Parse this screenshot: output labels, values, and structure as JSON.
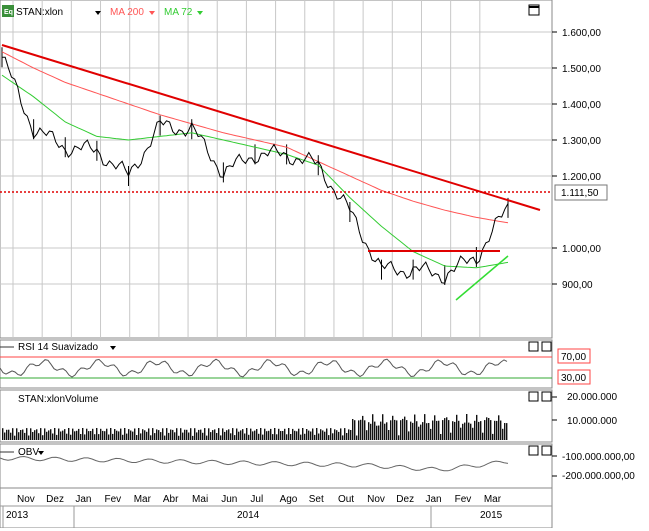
{
  "colors": {
    "price": "#000000",
    "ma200": "#ff5555",
    "ma72": "#33cc33",
    "trendline": "#e00000",
    "support_line": "#33dd33",
    "rsi_band": "#ff4444",
    "rsi_mid": "#33aa33",
    "grid": "#c8c8c8",
    "axis_text": "#000000"
  },
  "main": {
    "symbol_label": "STAN:xlon",
    "symbol_icon": "eq-badge",
    "ma200_label": "MA 200",
    "ma72_label": "MA 72",
    "last_price_label": "1.111,50",
    "y_ticks": [
      {
        "value": 1600,
        "label": "1.600,00"
      },
      {
        "value": 1500,
        "label": "1.500,00"
      },
      {
        "value": 1400,
        "label": "1.400,00"
      },
      {
        "value": 1300,
        "label": "1.300,00"
      },
      {
        "value": 1200,
        "label": "1.200,00"
      },
      {
        "value": 1000,
        "label": "1.000,00"
      },
      {
        "value": 900,
        "label": "900,00"
      }
    ]
  },
  "rsi": {
    "label": "RSI 14 Suavizado",
    "upper_label": "70,00",
    "lower_label": "30,00"
  },
  "volume": {
    "label": "STAN:xlonVolume",
    "ticks": [
      "20.000.000",
      "10.000.000"
    ]
  },
  "obv": {
    "label": "OBV",
    "ticks": [
      "-100.000.000,00",
      "-200.000.000,00"
    ]
  },
  "x_axis": {
    "months": [
      "Nov",
      "Dez",
      "Jan",
      "Fev",
      "Mar",
      "Abr",
      "Mai",
      "Jun",
      "Jul",
      "Ago",
      "Set",
      "Out",
      "Nov",
      "Dez",
      "Jan",
      "Fev",
      "Mar"
    ],
    "years": [
      "2013",
      "2014",
      "2015"
    ]
  },
  "chart_data": {
    "type": "line",
    "title": "STAN:xlon",
    "ylim": [
      820,
      1650
    ],
    "ylabel": "",
    "xlabel": "",
    "x": [
      "Nov 2013",
      "Dez 2013",
      "Jan 2014",
      "Fev 2014",
      "Mar 2014",
      "Abr 2014",
      "Mai 2014",
      "Jun 2014",
      "Jul 2014",
      "Ago 2014",
      "Set 2014",
      "Out 2014",
      "Nov 2014",
      "Dez 2014",
      "Jan 2015",
      "Fev 2015",
      "Mar 2015"
    ],
    "series": [
      {
        "name": "STAN:xlon",
        "values": [
          1530,
          1330,
          1280,
          1270,
          1200,
          1340,
          1330,
          1210,
          1260,
          1260,
          1230,
          1100,
          940,
          940,
          925,
          975,
          1111.5
        ]
      },
      {
        "name": "MA 200",
        "values": [
          1545,
          1500,
          1460,
          1430,
          1400,
          1370,
          1345,
          1320,
          1300,
          1280,
          1240,
          1200,
          1160,
          1130,
          1105,
          1085,
          1070
        ]
      },
      {
        "name": "MA 72",
        "values": [
          1480,
          1420,
          1350,
          1310,
          1300,
          1310,
          1320,
          1300,
          1280,
          1260,
          1230,
          1140,
          1060,
          990,
          950,
          945,
          960
        ]
      }
    ]
  }
}
